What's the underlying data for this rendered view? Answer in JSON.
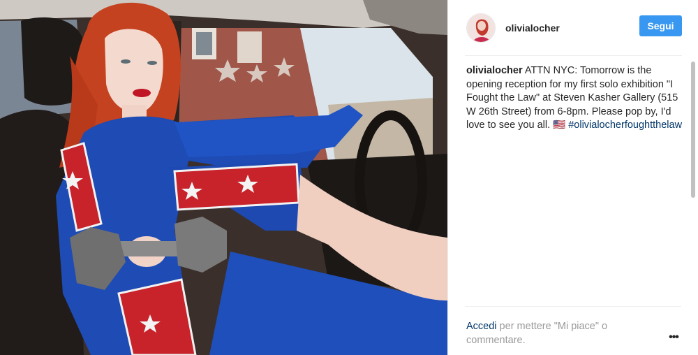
{
  "post": {
    "photo_alt_icon": "post-photo",
    "author": {
      "username": "olivialocher",
      "avatar_icon": "profile-avatar"
    },
    "follow_label": "Segui",
    "caption": {
      "username": "olivialocher",
      "text": " ATTN NYC: Tomorrow is the opening reception for my first solo exhibition \"I Fought the Law\" at Steven Kasher Gallery (515 W 26th Street) from 6-8pm. Please pop by, I'd love to see you all. 🇺🇸 ",
      "hashtag": "#olivialocherfoughtthelaw"
    },
    "footer": {
      "login_link": "Accedi",
      "login_suffix": " per mettere \"Mi piace\" o commentare."
    },
    "more_options_label": "•••"
  },
  "colors": {
    "accent": "#3897f0",
    "link": "#003569",
    "muted": "#999999",
    "text": "#262626"
  }
}
